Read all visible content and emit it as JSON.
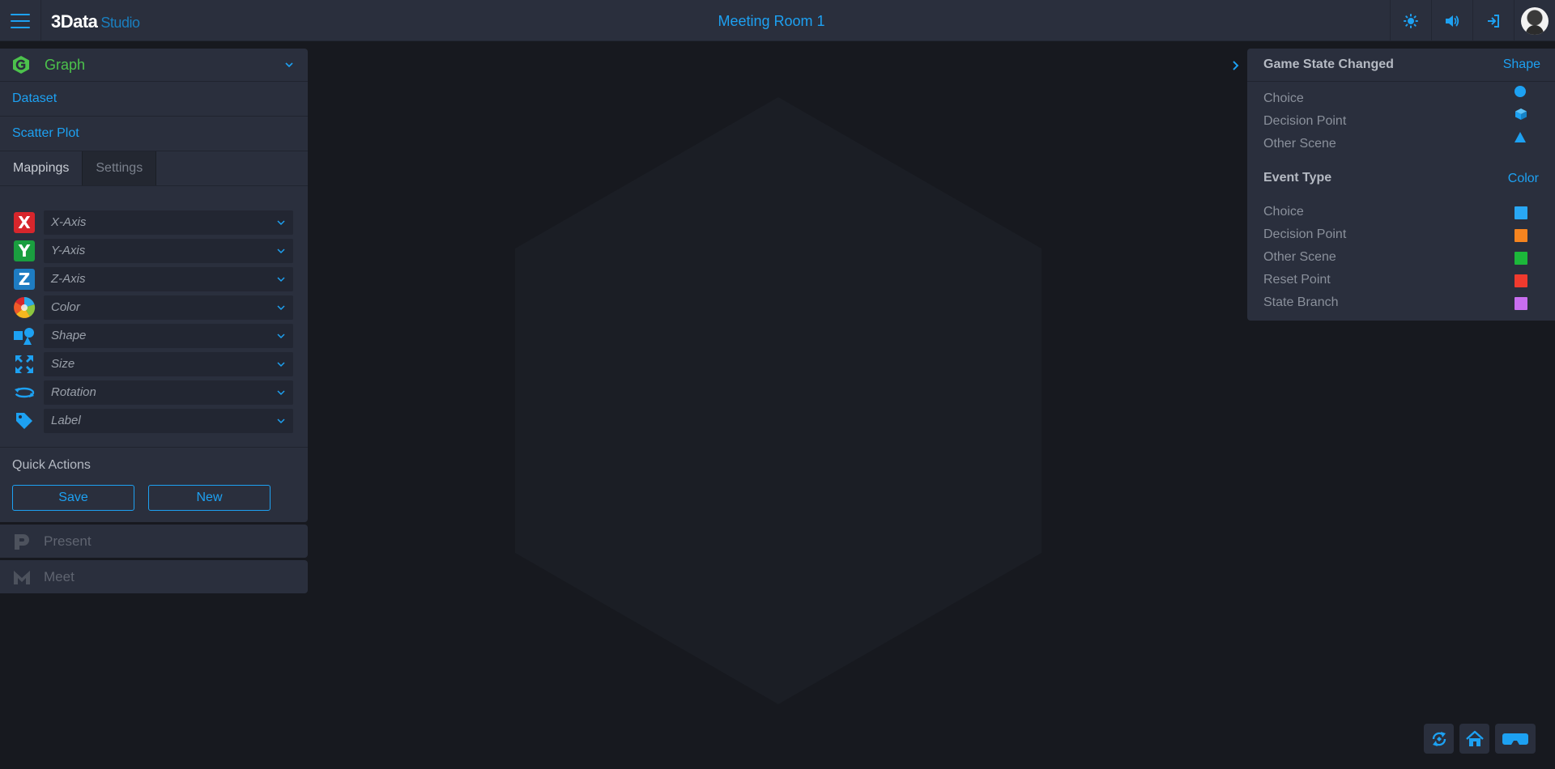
{
  "app": {
    "logo_main": "3Data",
    "logo_sub": "Studio",
    "room_title": "Meeting Room 1"
  },
  "topbar": {
    "icons": [
      "brightness-icon",
      "volume-icon",
      "exit-icon",
      "user-avatar"
    ]
  },
  "left_panel": {
    "title": "Graph",
    "dataset_label": "Dataset",
    "chart_type_label": "Scatter Plot",
    "tabs": [
      {
        "label": "Mappings",
        "active": true
      },
      {
        "label": "Settings",
        "active": false
      }
    ],
    "mappings": [
      {
        "label": "X-Axis",
        "icon": "x-axis-icon"
      },
      {
        "label": "Y-Axis",
        "icon": "y-axis-icon"
      },
      {
        "label": "Z-Axis",
        "icon": "z-axis-icon"
      },
      {
        "label": "Color",
        "icon": "color-wheel-icon"
      },
      {
        "label": "Shape",
        "icon": "shapes-icon"
      },
      {
        "label": "Size",
        "icon": "resize-icon"
      },
      {
        "label": "Rotation",
        "icon": "rotation-icon"
      },
      {
        "label": "Label",
        "icon": "tag-icon"
      }
    ],
    "quick_actions": {
      "title": "Quick Actions",
      "save_label": "Save",
      "new_label": "New"
    }
  },
  "collapsed_panels": {
    "present_label": "Present",
    "meet_label": "Meet"
  },
  "legend": {
    "shape_section": {
      "title": "Game State Changed",
      "link": "Shape",
      "items": [
        {
          "label": "Choice",
          "shape": "circle"
        },
        {
          "label": "Decision Point",
          "shape": "cube"
        },
        {
          "label": "Other Scene",
          "shape": "triangle"
        }
      ]
    },
    "color_section": {
      "title": "Event Type",
      "link": "Color",
      "items": [
        {
          "label": "Choice",
          "color": "#29a8f5"
        },
        {
          "label": "Decision Point",
          "color": "#f5841f"
        },
        {
          "label": "Other Scene",
          "color": "#1cb83a"
        },
        {
          "label": "Reset Point",
          "color": "#f03a2e"
        },
        {
          "label": "State Branch",
          "color": "#c86ef0"
        }
      ]
    }
  },
  "bottom_controls": [
    "reset-view-icon",
    "home-icon",
    "vr-headset-icon"
  ],
  "colors": {
    "accent": "#1da1f2",
    "graph_green": "#4cc24c",
    "panel_bg": "#2a2f3d",
    "canvas_bg": "#17191f"
  }
}
